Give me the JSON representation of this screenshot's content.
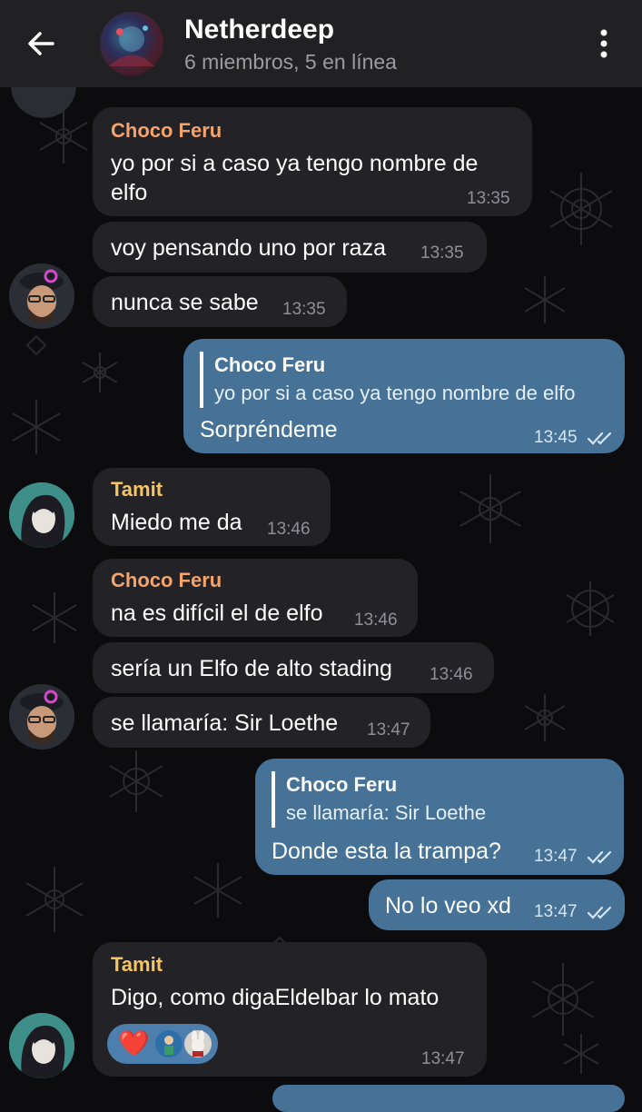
{
  "header": {
    "title": "Netherdeep",
    "subtitle": "6 miembros, 5 en línea"
  },
  "colors": {
    "choco_feru": "#f4a36c",
    "tamit": "#f5c563",
    "outgoing_bubble": "#467297",
    "incoming_bubble": "#232327"
  },
  "messages": {
    "m1_sender": "Choco Feru",
    "m1_line1": "yo por si a caso ya tengo nombre de",
    "m1_line2": "elfo",
    "m1_time": "13:35",
    "m2_text": "voy pensando uno por raza",
    "m2_time": "13:35",
    "m3_text": "nunca se sabe",
    "m3_time": "13:35",
    "o1_quote_name": "Choco Feru",
    "o1_quote_text": "yo por si a caso ya tengo nombre de elfo",
    "o1_text": "Sorpréndeme",
    "o1_time": "13:45",
    "m4_sender": "Tamit",
    "m4_text": "Miedo me da",
    "m4_time": "13:46",
    "m5_sender": "Choco Feru",
    "m5_text": "na es difícil el de elfo",
    "m5_time": "13:46",
    "m6_text": "sería un Elfo de alto stading",
    "m6_time": "13:46",
    "m7_text": "se llamaría: Sir Loethe",
    "m7_time": "13:47",
    "o2_quote_name": "Choco Feru",
    "o2_quote_text": "se llamaría: Sir Loethe",
    "o2_text": "Donde esta la trampa?",
    "o2_time": "13:47",
    "o3_text": "No lo veo xd",
    "o3_time": "13:47",
    "m8_sender": "Tamit",
    "m8_text": "Digo, como digaEldelbar lo mato",
    "m8_time": "13:47",
    "m8_reaction": "❤️"
  }
}
